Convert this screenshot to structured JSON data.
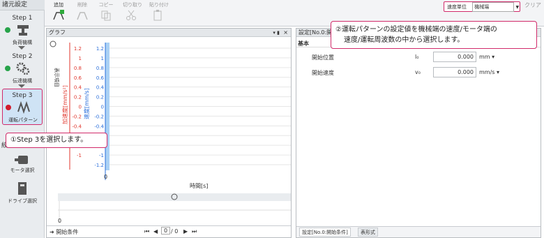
{
  "sidebar": {
    "title": "諸元設定",
    "steps": [
      {
        "step": "Step 1",
        "label": "負荷機構",
        "status": "ok"
      },
      {
        "step": "Step 2",
        "label": "伝達機構",
        "status": "ok"
      },
      {
        "step": "Step 3",
        "label": "運転パターン",
        "status": "error"
      }
    ],
    "partial_label": "絞",
    "tools": [
      {
        "label": "モータ選択"
      },
      {
        "label": "ドライブ選択"
      }
    ]
  },
  "toolbar": {
    "add": "追加",
    "delete": "削除",
    "copy": "コピー",
    "cut": "切り取り",
    "paste": "貼り付け",
    "clear": "クリア",
    "speed_unit_label": "速度単位",
    "speed_unit_value": "機械端"
  },
  "graph": {
    "title": "グラフ",
    "side_label": "表示項目",
    "accel_axis_label": "加速度[mm/s²]",
    "speed_axis_label": "速度[mm/s]",
    "x_axis_label": "時間[s]",
    "x_origin": "0",
    "lower_origin": "0",
    "start_condition": "開始条件",
    "page": "0",
    "page_total": "/ 0"
  },
  "chart_data": {
    "type": "line",
    "title": "",
    "xlabel": "時間[s]",
    "x": [
      0
    ],
    "ylim": [
      -1.2,
      1.2
    ],
    "yticks": [
      "1.2",
      "1",
      "0.8",
      "0.6",
      "0.4",
      "0.2",
      "0",
      "-0.2",
      "-0.4",
      "-0.6",
      "-0.8",
      "-1",
      "-1.2"
    ],
    "left_yticks": [
      "1.2",
      "1",
      "0.8",
      "0.6",
      "0.4",
      "0.2",
      "0",
      "-0.2",
      "-0.4",
      "-0.6",
      "-0.8",
      "-1"
    ],
    "y_axes": [
      {
        "label": "加速度[mm/s²]",
        "color": "#e0362c"
      },
      {
        "label": "速度[mm/s]",
        "color": "#2a6fdb"
      }
    ],
    "series": [],
    "grid": true
  },
  "settings": {
    "title": "設定[No.0:開",
    "section": "基本",
    "fields": [
      {
        "label": "開始位置",
        "symbol": "l₀",
        "value": "0.000",
        "unit": "mm"
      },
      {
        "label": "開始速度",
        "symbol": "v₀",
        "value": "0.000",
        "unit": "mm/s"
      }
    ],
    "tabs": [
      "設定[No.0:開始条件]",
      "表形式"
    ]
  },
  "callouts": {
    "step3": "①Step 3を選択します。",
    "speed_line1": "②運転パターンの設定値を機械端の速度/モータ端の",
    "speed_line2": "速度/運転周波数の中から選択します。"
  },
  "colors": {
    "accent": "#d12a6a",
    "accel_axis": "#e0362c",
    "speed_axis": "#2a6fdb",
    "ok": "#27a34a",
    "error": "#d11b2d"
  }
}
